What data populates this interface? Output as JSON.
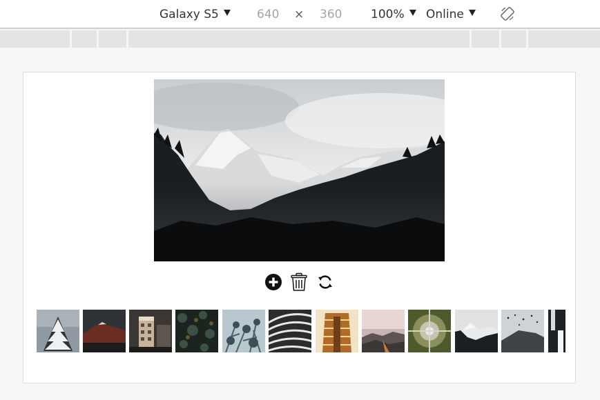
{
  "toolbar": {
    "device": "Galaxy S5",
    "width": "640",
    "times": "×",
    "height": "360",
    "zoom": "100%",
    "network": "Online"
  },
  "icons": {
    "rotate": "rotate-icon",
    "add": "add-circle-icon",
    "delete": "trash-icon",
    "refresh": "refresh-icon"
  },
  "gallery": {
    "thumbnails": [
      {
        "subject": "snowy-pine"
      },
      {
        "subject": "mountain-red"
      },
      {
        "subject": "building-dusk"
      },
      {
        "subject": "dark-leaves"
      },
      {
        "subject": "frosty-branches"
      },
      {
        "subject": "curved-building"
      },
      {
        "subject": "atrium-lights"
      },
      {
        "subject": "valley-dusk"
      },
      {
        "subject": "aerial-fountain"
      },
      {
        "subject": "misty-mountain"
      },
      {
        "subject": "birds-hill"
      },
      {
        "subject": "partial"
      }
    ]
  }
}
